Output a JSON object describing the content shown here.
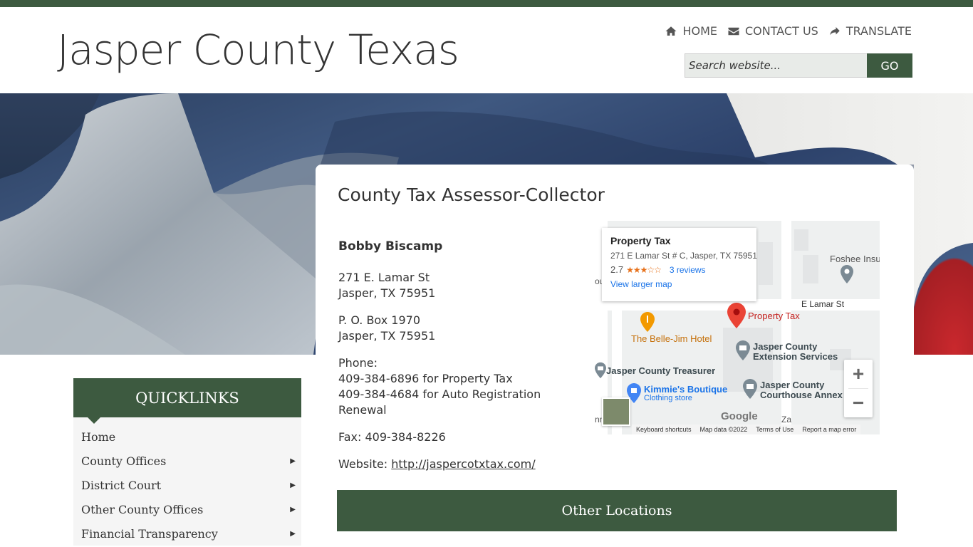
{
  "site": {
    "title": "Jasper County Texas"
  },
  "nav": {
    "home": "HOME",
    "contact": "CONTACT US",
    "translate": "TRANSLATE"
  },
  "search": {
    "placeholder": "Search website...",
    "button": "GO"
  },
  "page": {
    "title": "County Tax Assessor-Collector"
  },
  "office": {
    "name": "Bobby Biscamp",
    "address_line1": "271 E. Lamar St",
    "address_line2": "Jasper, TX 75951",
    "po_line1": "P. O. Box 1970",
    "po_line2": "Jasper, TX 75951",
    "phone_label": "Phone:",
    "phone1": "409-384-6896 for Property Tax",
    "phone2": "409-384-4684 for Auto Registration Renewal",
    "fax": "Fax: 409-384-8226",
    "website_label": "Website:",
    "website_url": "http://jaspercotxtax.com/"
  },
  "map": {
    "popup_title": "Property Tax",
    "popup_address": "271 E Lamar St # C, Jasper, TX 75951",
    "rating": "2.7",
    "stars": "★★★☆☆",
    "reviews": "3 reviews",
    "larger_map": "View larger map",
    "labels": {
      "foshee": "Foshee Insu",
      "e_lamar": "E Lamar St",
      "property_tax": "Property Tax",
      "belle_jim": "The Belle-Jim Hotel",
      "extension_1": "Jasper County",
      "extension_2": "Extension Services",
      "treasurer": "Jasper County Treasurer",
      "kimmies": "Kimmie's Boutique",
      "kimmies_sub": "Clothing store",
      "annex_1": "Jasper County",
      "annex_2": "Courthouse Annex",
      "google": "Google",
      "ou": "ou",
      "nn": "nn",
      "za": "Za"
    },
    "footer": {
      "shortcuts": "Keyboard shortcuts",
      "data": "Map data ©2022",
      "terms": "Terms of Use",
      "report": "Report a map error"
    },
    "zoom_in": "+",
    "zoom_out": "−"
  },
  "quicklinks": {
    "title": "QUICKLINKS",
    "items": [
      {
        "label": "Home",
        "arrow": ""
      },
      {
        "label": "County Offices",
        "arrow": "▶"
      },
      {
        "label": "District Court",
        "arrow": "▶"
      },
      {
        "label": "Other County Offices",
        "arrow": "▶"
      },
      {
        "label": "Financial Transparency",
        "arrow": "▶"
      }
    ]
  },
  "other_locations": {
    "title": "Other Locations"
  },
  "colors": {
    "brand_green": "#3d5a40",
    "link_blue": "#1a73e8",
    "pin_red": "#ea4335"
  }
}
